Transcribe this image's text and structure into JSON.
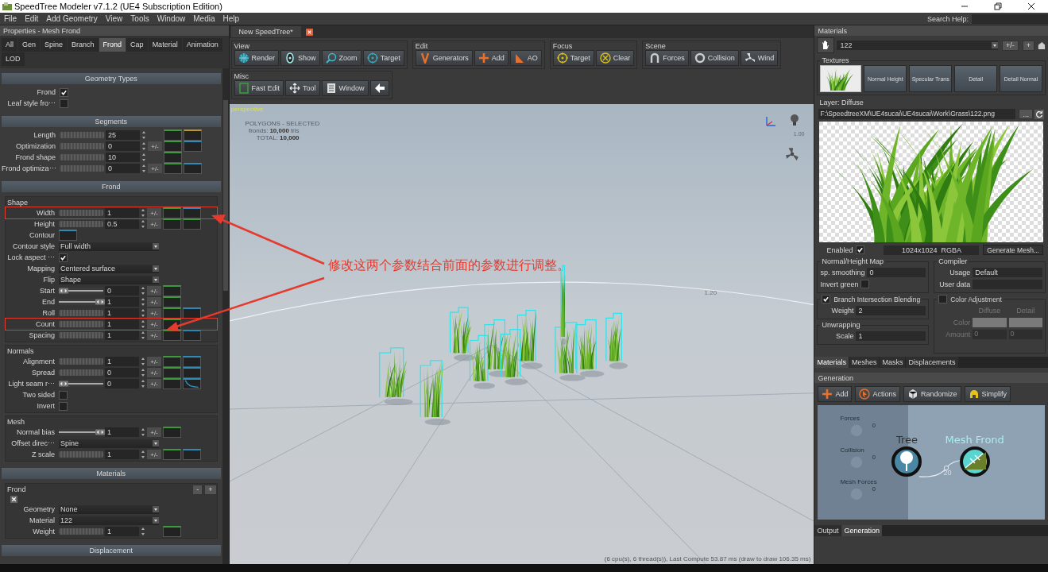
{
  "window": {
    "title": "SpeedTree Modeler v7.1.2 (UE4 Subscription Edition)"
  },
  "menu": [
    "File",
    "Edit",
    "Add Geometry",
    "View",
    "Tools",
    "Window",
    "Media",
    "Help"
  ],
  "search_help": {
    "label": "Search Help:"
  },
  "properties": {
    "title": "Properties - Mesh Frond",
    "tabs": [
      {
        "label": "All",
        "selected": false
      },
      {
        "label": "Gen",
        "selected": false
      },
      {
        "label": "Spine",
        "selected": false
      },
      {
        "label": "Branch",
        "selected": false
      },
      {
        "label": "Frond",
        "selected": true
      },
      {
        "label": "Cap",
        "selected": false
      },
      {
        "label": "Material",
        "selected": false
      },
      {
        "label": "Animation",
        "selected": false
      },
      {
        "label": "LOD",
        "selected": false
      }
    ],
    "sections": [
      {
        "title": "Geometry Types",
        "groups": [
          {
            "rows": [
              {
                "kind": "check",
                "label": "Frond",
                "checked": true
              },
              {
                "kind": "check",
                "label": "Leaf style fro⋯",
                "checked": false
              }
            ]
          }
        ]
      },
      {
        "title": "Segments",
        "groups": [
          {
            "rows": [
              {
                "kind": "slider",
                "label": "Length",
                "value": "25",
                "curves": [
                  {
                    "color": "#3c9a3c"
                  },
                  {
                    "color": "#b89a2a"
                  }
                ]
              },
              {
                "kind": "slider",
                "label": "Optimization",
                "value": "0",
                "toggle": "+/-",
                "curves": [
                  {
                    "color": "#3c9a3c"
                  },
                  {
                    "color": "#2e8bb8"
                  }
                ]
              },
              {
                "kind": "slider",
                "label": "Frond shape",
                "value": "10",
                "curves": [
                  {
                    "color": "#3c9a3c"
                  }
                ]
              },
              {
                "kind": "slider",
                "label": "Frond optimiza⋯",
                "value": "0",
                "toggle": "+/-",
                "curves": [
                  {
                    "color": "#3c9a3c"
                  },
                  {
                    "color": "#2e8bb8"
                  }
                ]
              }
            ]
          }
        ]
      },
      {
        "title": "Frond",
        "groups": [
          {
            "title": "Shape",
            "rows": [
              {
                "kind": "slider",
                "label": "Width",
                "value": "1",
                "toggle": "+/-",
                "highlighted": true,
                "curves": [
                  {
                    "color": "#3c9a3c"
                  },
                  {
                    "color": "#2e8bb8"
                  }
                ]
              },
              {
                "kind": "slider",
                "label": "Height",
                "value": "0.5",
                "toggle": "+/-",
                "highlighted": false,
                "curves": [
                  {
                    "color": "#3c9a3c"
                  },
                  {
                    "color": "#3c9a3c"
                  }
                ]
              },
              {
                "kind": "curve",
                "label": "Contour",
                "highlighted": false,
                "curves": [
                  {
                    "color": "#2e8bb8"
                  }
                ]
              },
              {
                "kind": "select",
                "label": "Contour style",
                "value": "Full width",
                "highlighted": false
              },
              {
                "kind": "check",
                "label": "Lock aspect ⋯",
                "checked": true,
                "highlighted": false
              },
              {
                "kind": "select",
                "label": "Mapping",
                "value": "Centered surface",
                "highlighted": false
              },
              {
                "kind": "select",
                "label": "Flip",
                "value": "Shape",
                "highlighted": false
              },
              {
                "kind": "range",
                "label": "Start",
                "level": 0,
                "value": "0",
                "toggle": "+/-",
                "highlighted": false,
                "curves": [
                  {
                    "color": "#3c9a3c"
                  }
                ]
              },
              {
                "kind": "range",
                "label": "End",
                "level": 1,
                "value": "1",
                "toggle": "+/-",
                "highlighted": false,
                "curves": [
                  {
                    "color": "#3c9a3c"
                  }
                ]
              },
              {
                "kind": "slider",
                "label": "Roll",
                "value": "1",
                "toggle": "+/-",
                "highlighted": false,
                "curves": [
                  {
                    "color": "#3c9a3c"
                  },
                  {
                    "color": "#2e8bb8"
                  }
                ]
              },
              {
                "kind": "slider",
                "label": "Count",
                "value": "1",
                "toggle": "+/-",
                "highlighted": true,
                "curves": [
                  {
                    "color": "#3c9a3c"
                  }
                ]
              },
              {
                "kind": "slider",
                "label": "Spacing",
                "value": "1",
                "toggle": "+/-",
                "highlighted": false,
                "curves": [
                  {
                    "color": "#3c9a3c"
                  },
                  {
                    "color": "#2e8bb8"
                  }
                ]
              }
            ]
          },
          {
            "title": "Normals",
            "rows": [
              {
                "kind": "slider",
                "label": "Alignment",
                "value": "1",
                "toggle": "+/-",
                "curves": [
                  {
                    "color": "#3c9a3c"
                  },
                  {
                    "color": "#2e8bb8"
                  }
                ]
              },
              {
                "kind": "slider",
                "label": "Spread",
                "value": "0",
                "toggle": "+/-",
                "curves": [
                  {
                    "color": "#3c9a3c"
                  },
                  {
                    "color": "#2e8bb8"
                  }
                ]
              },
              {
                "kind": "range",
                "label": "Light seam r⋯",
                "level": 0,
                "value": "0",
                "toggle": "+/-",
                "curves": [
                  {
                    "kind": "flat",
                    "color": "#3c9a3c"
                  },
                  {
                    "kind": "falloff",
                    "color": "#2e8bb8"
                  }
                ]
              },
              {
                "kind": "check",
                "label": "Two sided",
                "checked": false
              },
              {
                "kind": "check",
                "label": "Invert",
                "checked": false
              }
            ]
          },
          {
            "title": "Mesh",
            "rows": [
              {
                "kind": "range",
                "label": "Normal bias",
                "level": 1,
                "value": "1",
                "toggle": "+/-",
                "curves": [
                  {
                    "color": "#3c9a3c"
                  }
                ]
              },
              {
                "kind": "select",
                "label": "Offset direc⋯",
                "value": "Spine"
              },
              {
                "kind": "slider",
                "label": "Z scale",
                "value": "1",
                "toggle": "+/-",
                "curves": [
                  {
                    "color": "#3c9a3c"
                  },
                  {
                    "color": "#2e8bb8"
                  }
                ]
              }
            ]
          }
        ]
      },
      {
        "title": "Materials",
        "groups": [
          {
            "title": "Frond",
            "buttons": [
              "-",
              "+"
            ],
            "removable": true,
            "rows": [
              {
                "kind": "select",
                "label": "Geometry",
                "value": "None"
              },
              {
                "kind": "select",
                "label": "Material",
                "value": "122"
              },
              {
                "kind": "slider",
                "label": "Weight",
                "value": "1",
                "curves": [
                  {
                    "color": "#3c9a3c"
                  }
                ]
              }
            ]
          }
        ]
      },
      {
        "title": "Displacement"
      }
    ]
  },
  "document_tab": {
    "label": "New SpeedTree*"
  },
  "toolbar_rows": [
    {
      "groups": [
        {
          "title": "View",
          "buttons": [
            {
              "label": "Render",
              "kind": "globe"
            },
            {
              "label": "Show",
              "kind": "eye"
            },
            {
              "label": "Zoom",
              "kind": "zoom"
            },
            {
              "label": "Target",
              "kind": "target"
            }
          ]
        },
        {
          "title": "Edit",
          "buttons": [
            {
              "label": "Generators",
              "kind": "fork"
            },
            {
              "label": "Add",
              "kind": "add"
            },
            {
              "label": "AO",
              "kind": "ao"
            }
          ]
        },
        {
          "title": "Focus",
          "buttons": [
            {
              "label": "Target",
              "kind": "focus"
            },
            {
              "label": "Clear",
              "kind": "clear"
            }
          ]
        },
        {
          "title": "Scene",
          "buttons": [
            {
              "label": "Forces",
              "kind": "magnet"
            },
            {
              "label": "Collision",
              "kind": "ring"
            },
            {
              "label": "Wind",
              "kind": "fan"
            }
          ]
        }
      ]
    },
    {
      "groups": [
        {
          "title": "Misc",
          "buttons": [
            {
              "label": "Fast Edit",
              "kind": "square"
            },
            {
              "label": "Tool",
              "kind": "move"
            },
            {
              "label": "Window",
              "kind": "list"
            },
            {
              "kind": "back"
            }
          ]
        }
      ]
    }
  ],
  "viewport": {
    "camera": "perspective",
    "stats": {
      "heading": "POLYGONS - SELECTED",
      "rows": [
        {
          "label": "fronds:",
          "value": "10,000",
          "unit": "tris"
        },
        {
          "label": "TOTAL:",
          "value": "10,000"
        }
      ]
    },
    "gizmo_scale": "1.00",
    "ring_scale": "1.20",
    "status": "(6 cpu(s), 6 thread(s)), Last Compute 53.87 ms (draw to draw 106.35 ms)"
  },
  "annotation": {
    "text": "修改这两个参数结合前面的参数进行调整。"
  },
  "materials_panel": {
    "title": "Materials",
    "material": "122",
    "buttons": [
      "+/-",
      "+"
    ],
    "textures_label": "Textures",
    "texture_slots": [
      {
        "kind": "image",
        "selected": true
      },
      {
        "kind": "text",
        "label": "Normal Height",
        "selected": false
      },
      {
        "kind": "text",
        "label": "Specular Trans",
        "selected": false
      },
      {
        "kind": "text",
        "label": "Detail",
        "selected": false
      },
      {
        "kind": "text",
        "label": "Detail Normal",
        "selected": false
      }
    ],
    "layer_label": "Layer: Diffuse",
    "path": "F:\\SpeedtreeXM\\UE4sucai\\UE4sucai\\Work\\Grass\\122.png",
    "browse": "...",
    "enabled": {
      "label": "Enabled",
      "checked": true
    },
    "resolution": "1024x1024  RGBA",
    "generate": "Generate Mesh...",
    "normal_height": {
      "title": "Normal/Height Map",
      "smoothing": {
        "label": "sp. smoothing",
        "value": "0"
      },
      "invert": {
        "label": "Invert green",
        "checked": false
      }
    },
    "compiler": {
      "title": "Compiler",
      "usage": {
        "label": "Usage",
        "value": "Default"
      },
      "user_data": {
        "label": "User data"
      }
    },
    "blending": {
      "title": "Branch Intersection Blending",
      "checked": true,
      "weight": {
        "label": "Weight",
        "value": "2"
      }
    },
    "color_adjustment": {
      "title": "Color Adjustment",
      "checked": false,
      "columns": [
        "Diffuse",
        "Detail"
      ],
      "color_label": "Color",
      "amount_label": "Amount",
      "amounts": [
        "0",
        "0"
      ]
    },
    "unwrapping": {
      "title": "Unwrapping",
      "scale": {
        "label": "Scale",
        "value": "1"
      }
    }
  },
  "right_tabs": [
    {
      "label": "Materials",
      "selected": true
    },
    {
      "label": "Meshes",
      "selected": false
    },
    {
      "label": "Masks",
      "selected": false
    },
    {
      "label": "Displacements",
      "selected": false
    }
  ],
  "generation": {
    "title": "Generation",
    "buttons": [
      {
        "label": "Add",
        "kind": "add"
      },
      {
        "label": "Actions",
        "kind": "actions"
      },
      {
        "label": "Randomize",
        "kind": "dice"
      },
      {
        "label": "Simplify",
        "kind": "simplify"
      }
    ],
    "side_nodes": [
      {
        "label": "Forces",
        "count": "0"
      },
      {
        "label": "Collision",
        "count": "0"
      },
      {
        "label": "Mesh Forces",
        "count": "0"
      }
    ],
    "nodes": [
      {
        "label": "Tree",
        "kind": "tree"
      },
      {
        "label": "Mesh Frond",
        "kind": "frond"
      }
    ],
    "link_label": "20"
  },
  "bottom_tabs": [
    {
      "label": "Output",
      "selected": false
    },
    {
      "label": "Generation",
      "selected": true
    }
  ]
}
